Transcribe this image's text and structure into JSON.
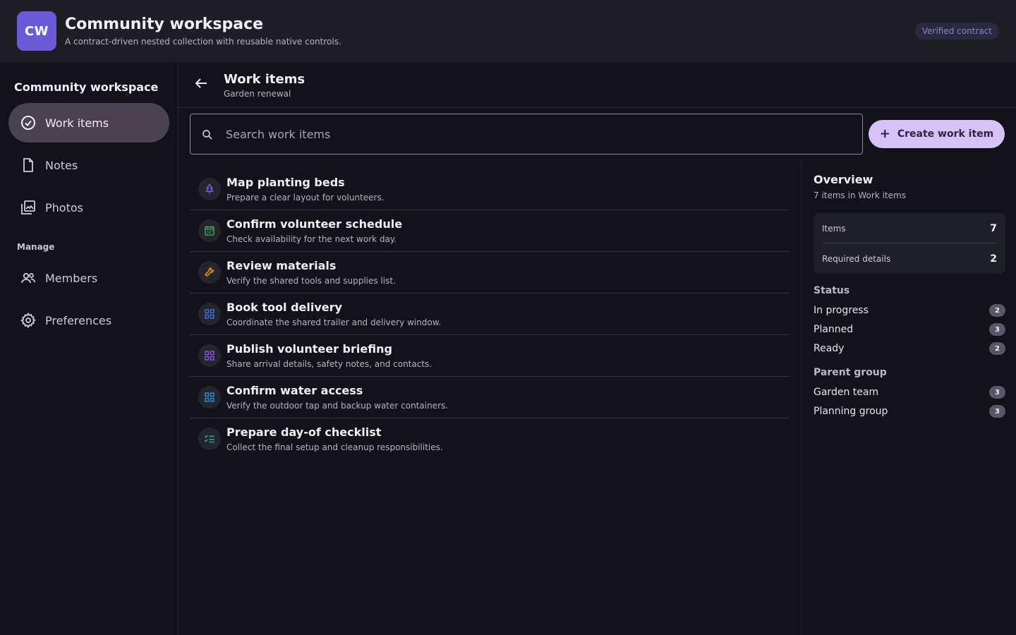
{
  "app": {
    "logo": "CW",
    "title": "Community workspace",
    "subtitle": "A contract-driven nested collection with reusable native controls.",
    "badge": "Verified contract"
  },
  "sidebar": {
    "workspace_title": "Community workspace",
    "items": [
      {
        "label": "Work items",
        "icon": "check-circle-icon",
        "active": true
      },
      {
        "label": "Notes",
        "icon": "document-icon"
      },
      {
        "label": "Photos",
        "icon": "photos-icon"
      }
    ],
    "manage_label": "Manage",
    "manage_items": [
      {
        "label": "Members",
        "icon": "people-icon"
      },
      {
        "label": "Preferences",
        "icon": "gear-icon"
      }
    ]
  },
  "main": {
    "title": "Work items",
    "subtitle": "Garden renewal",
    "search_placeholder": "Search work items",
    "create_label": "Create work item",
    "items": [
      {
        "title": "Map planting beds",
        "desc": "Prepare a clear layout for volunteers.",
        "icon": "tree-icon",
        "color": "#6d5ee0"
      },
      {
        "title": "Confirm volunteer schedule",
        "desc": "Check availability for the next work day.",
        "icon": "calendar-icon",
        "color": "#3fa05a"
      },
      {
        "title": "Review materials",
        "desc": "Verify the shared tools and supplies list.",
        "icon": "wrench-icon",
        "color": "#e08a1e"
      },
      {
        "title": "Book tool delivery",
        "desc": "Coordinate the shared trailer and delivery window.",
        "icon": "grid-icon",
        "color": "#3f6fd8"
      },
      {
        "title": "Publish volunteer briefing",
        "desc": "Share arrival details, safety notes, and contacts.",
        "icon": "grid-icon",
        "color": "#8a4fd8"
      },
      {
        "title": "Confirm water access",
        "desc": "Verify the outdoor tap and backup water containers.",
        "icon": "grid-icon",
        "color": "#2c8ad0"
      },
      {
        "title": "Prepare day-of checklist",
        "desc": "Collect the final setup and cleanup responsibilities.",
        "icon": "checklist-icon",
        "color": "#2fa088"
      }
    ]
  },
  "panel": {
    "title": "Overview",
    "subtitle": "7 items in Work items",
    "stats": [
      {
        "label": "Items",
        "value": "7"
      },
      {
        "label": "Required details",
        "value": "2"
      }
    ],
    "status_label": "Status",
    "status": [
      {
        "label": "In progress",
        "count": "2"
      },
      {
        "label": "Planned",
        "count": "3"
      },
      {
        "label": "Ready",
        "count": "2"
      }
    ],
    "parent_label": "Parent group",
    "parents": [
      {
        "label": "Garden team",
        "count": "3"
      },
      {
        "label": "Planning group",
        "count": "3"
      }
    ]
  }
}
